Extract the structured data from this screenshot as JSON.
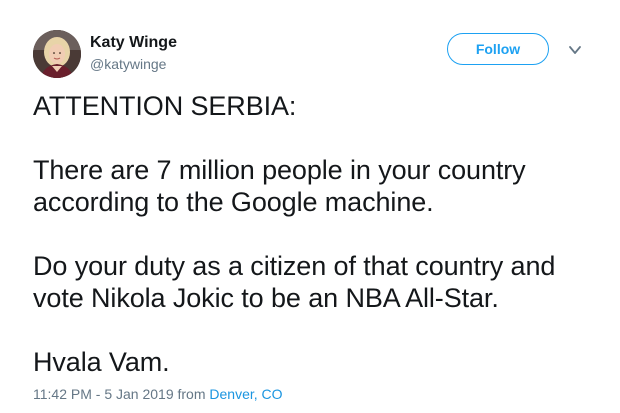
{
  "author": {
    "name": "Katy Winge",
    "handle": "@katywinge",
    "avatar_icon": "profile-photo"
  },
  "header": {
    "follow_label": "Follow",
    "menu_icon": "chevron-down-icon"
  },
  "tweet": {
    "paragraphs": [
      "ATTENTION SERBIA:",
      "There are 7 million people in your country according to the Google machine.",
      "Do your duty as a citizen of that country and vote Nikola Jokic to be an NBA All-Star.",
      "Hvala Vam."
    ]
  },
  "meta": {
    "timestamp": "11:42 PM - 5 Jan 2019",
    "from_label": "from",
    "location": "Denver, CO"
  },
  "colors": {
    "accent": "#1da1f2",
    "link": "#1b95e0",
    "secondary_text": "#657786",
    "primary_text": "#14171a"
  }
}
